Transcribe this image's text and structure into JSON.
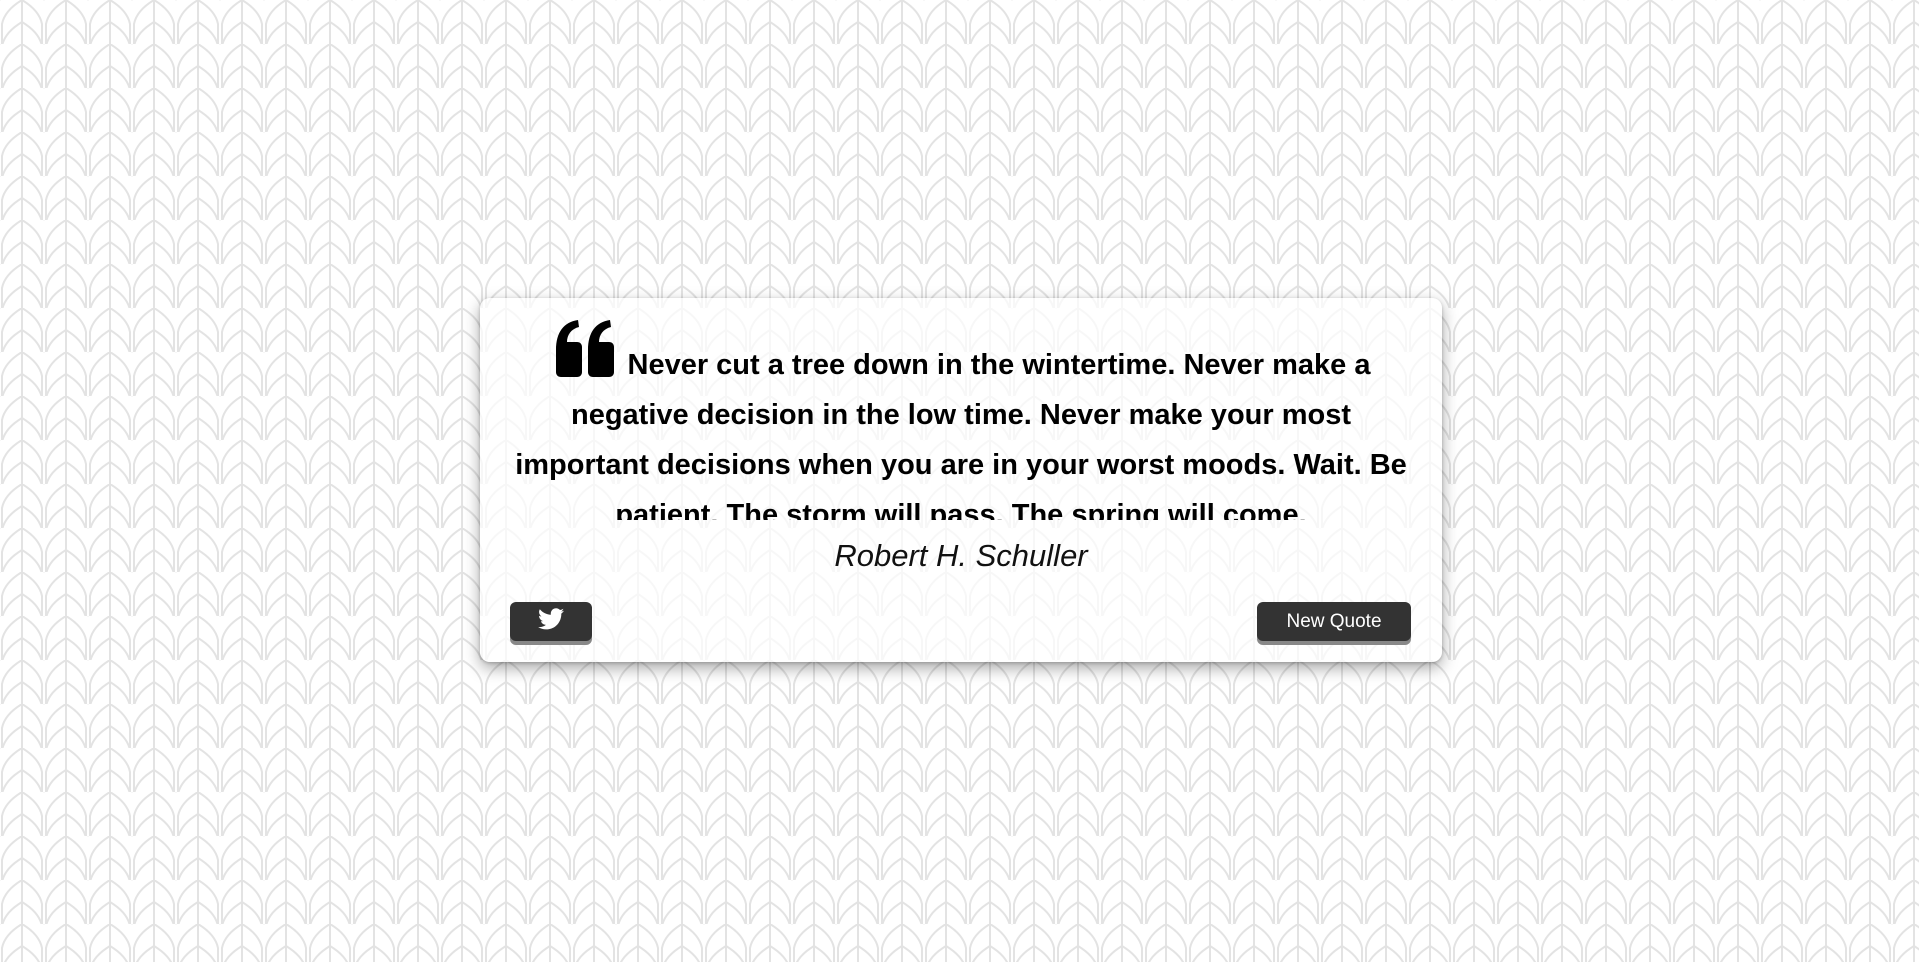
{
  "quote": {
    "text": "Never cut a tree down in the wintertime. Never make a negative decision in the low time. Never make your most important decisions when you are in your worst moods. Wait. Be patient. The storm will pass. The spring will come.",
    "author": "Robert H. Schuller",
    "icon": "quote-left-icon"
  },
  "actions": {
    "tweet_icon": "twitter-icon",
    "new_quote_label": "New Quote"
  },
  "colors": {
    "button_bg": "#333333",
    "button_text": "#ffffff",
    "card_bg": "#ffffff",
    "pattern_stroke": "#e6e6e6"
  }
}
